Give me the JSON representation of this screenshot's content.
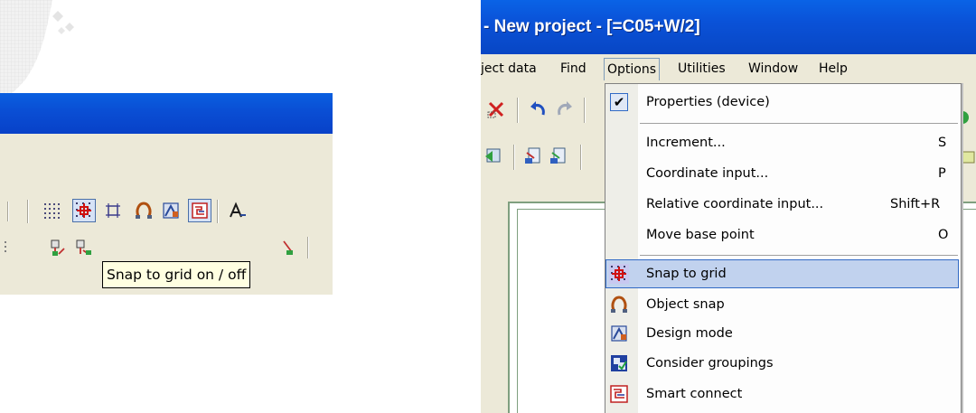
{
  "right_window": {
    "title": "- New project - [=C05+W/2]",
    "menubar": {
      "items": [
        {
          "label": "ject data",
          "active": false
        },
        {
          "label": "Find",
          "active": false
        },
        {
          "label": "Options",
          "active": true
        },
        {
          "label": "Utilities",
          "active": false
        },
        {
          "label": "Window",
          "active": false
        },
        {
          "label": "Help",
          "active": false
        }
      ]
    },
    "options_menu": {
      "items": [
        {
          "label": "Properties (device)",
          "shortcut": "",
          "icon": "checkmark-icon",
          "checked": true
        },
        {
          "label": "Increment...",
          "shortcut": "S",
          "icon": ""
        },
        {
          "label": "Coordinate input...",
          "shortcut": "P",
          "icon": ""
        },
        {
          "label": "Relative coordinate input...",
          "shortcut": "Shift+R",
          "icon": ""
        },
        {
          "label": "Move base point",
          "shortcut": "O",
          "icon": ""
        },
        {
          "label": "Snap to grid",
          "shortcut": "",
          "icon": "snap-to-grid-icon",
          "highlighted": true
        },
        {
          "label": "Object snap",
          "shortcut": "",
          "icon": "object-snap-icon"
        },
        {
          "label": "Design mode",
          "shortcut": "",
          "icon": "design-mode-icon"
        },
        {
          "label": "Consider groupings",
          "shortcut": "",
          "icon": "consider-groupings-icon"
        },
        {
          "label": "Smart connect",
          "shortcut": "",
          "icon": "smart-connect-icon"
        }
      ]
    }
  },
  "left_toolbar": {
    "tooltip": "Snap to grid on / off"
  },
  "colors": {
    "titlebar": "#0a52d8",
    "menu_highlight": "#c1d2ee",
    "menu_highlight_border": "#316ac5",
    "tooltip_bg": "#ffffe1",
    "toolbar_bg": "#ece9d8"
  }
}
